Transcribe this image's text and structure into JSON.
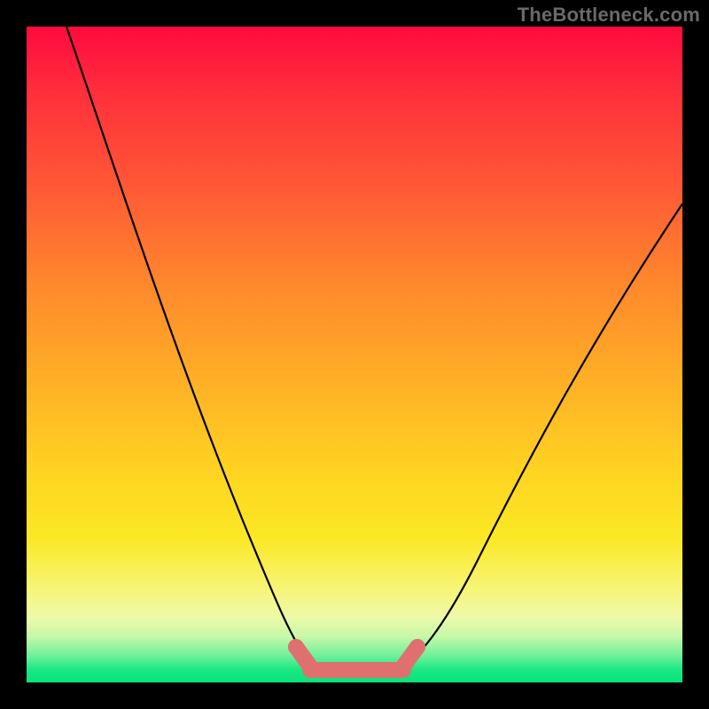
{
  "watermark": "TheBottleneck.com",
  "colors": {
    "background": "#000000",
    "curve": "#000000",
    "marker": "#e07070",
    "gradient_top": "#ff0a3e",
    "gradient_bottom": "#07e47a"
  },
  "chart_data": {
    "type": "line",
    "title": "",
    "xlabel": "",
    "ylabel": "",
    "xlim": [
      0,
      100
    ],
    "ylim": [
      0,
      100
    ],
    "grid": false,
    "legend": false,
    "series": [
      {
        "name": "bottleneck-curve",
        "x": [
          0,
          5,
          10,
          15,
          20,
          25,
          30,
          35,
          38,
          41,
          44,
          47,
          50,
          53,
          56,
          60,
          65,
          70,
          75,
          80,
          85,
          90,
          95,
          100
        ],
        "values": [
          100,
          93,
          86,
          78,
          70,
          62,
          53,
          43,
          35,
          26,
          16,
          7,
          2,
          0,
          0,
          2,
          10,
          22,
          33,
          43,
          53,
          62,
          70,
          78
        ]
      }
    ],
    "annotations": [
      {
        "name": "flat-bottom-band",
        "x_start": 41,
        "x_end": 60,
        "y": 1.5,
        "style": "thick-salmon"
      }
    ]
  }
}
